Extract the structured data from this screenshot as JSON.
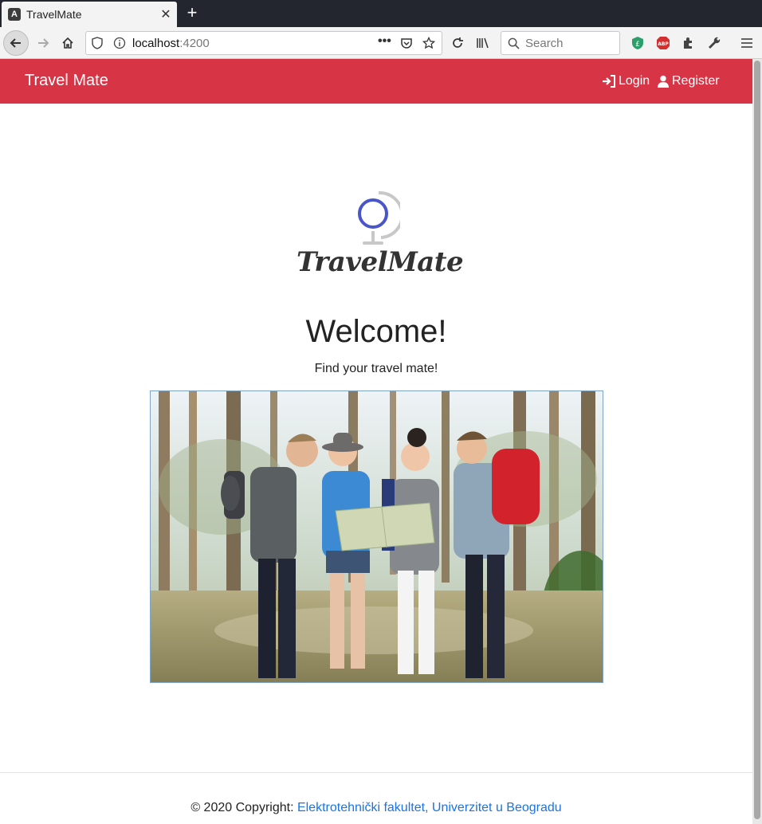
{
  "browser": {
    "tab_title": "TravelMate",
    "tab_favicon_letter": "A",
    "url_host": "localhost",
    "url_port": ":4200",
    "search_placeholder": "Search",
    "new_tab_label": "+"
  },
  "header": {
    "brand": "Travel Mate",
    "login_label": "Login",
    "register_label": "Register",
    "color": "#d73545"
  },
  "logo": {
    "wordmark": "TravelMate",
    "globe_color": "#4a56c8"
  },
  "main": {
    "title": "Welcome!",
    "tagline": "Find your travel mate!",
    "hero_image": "group-of-hikers-reading-map-in-forest"
  },
  "footer": {
    "copyright_prefix": "© 2020 Copyright: ",
    "copyright_link": "Elektrotehnički fakultet, Univerzitet u Beogradu"
  }
}
